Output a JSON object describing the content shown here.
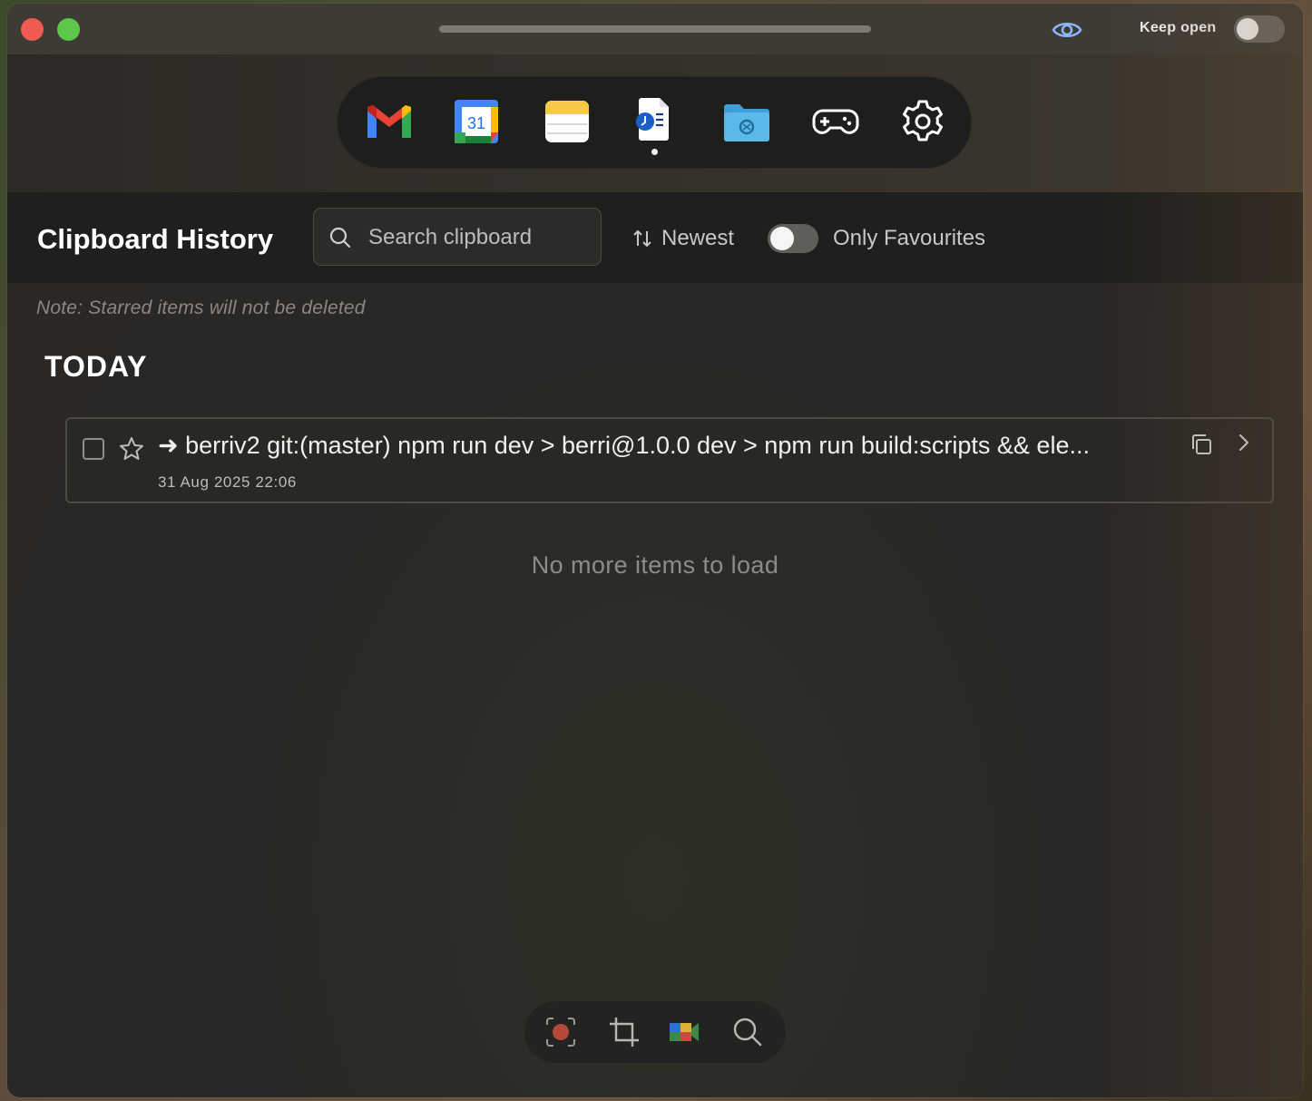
{
  "titlebar": {
    "keep_open_label": "Keep open",
    "keep_open_on": false
  },
  "dock": {
    "apps": [
      {
        "name": "gmail-icon"
      },
      {
        "name": "calendar-icon",
        "text": "31"
      },
      {
        "name": "notes-icon"
      },
      {
        "name": "clipboard-history-icon",
        "active": true
      },
      {
        "name": "files-icon"
      },
      {
        "name": "gamepad-icon"
      },
      {
        "name": "gear-icon"
      }
    ]
  },
  "header": {
    "title": "Clipboard History",
    "search_placeholder": "Search clipboard",
    "sort_label": "Newest",
    "favourites_label": "Only Favourites",
    "favourites_on": false
  },
  "note": "Note: Starred items will not be deleted",
  "sections": [
    {
      "title": "TODAY",
      "items": [
        {
          "text": "➜ berriv2 git:(master) npm run dev > berri@1.0.0 dev > npm run build:scripts && ele...",
          "time": "31 Aug 2025 22:06",
          "starred": false,
          "checked": false
        }
      ]
    }
  ],
  "empty_message": "No more items to load",
  "toolbar": {
    "tools": [
      "screen-record-icon",
      "crop-icon",
      "video-call-icon",
      "search-icon"
    ]
  },
  "colors": {
    "close": "#ee5b52",
    "maximize": "#5cc748",
    "eye": "#8ab4f8"
  }
}
